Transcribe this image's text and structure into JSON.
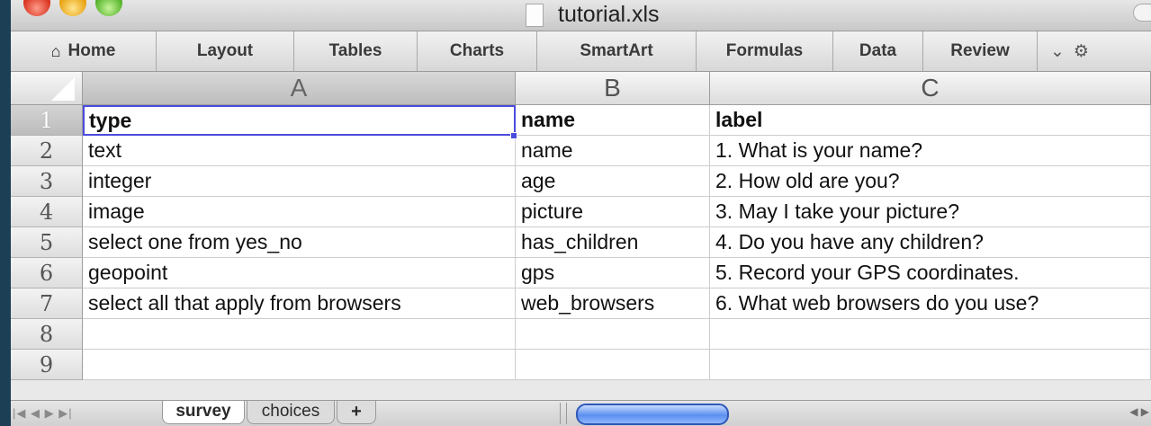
{
  "window": {
    "title": "tutorial.xls"
  },
  "ribbon": {
    "tabs": [
      "Home",
      "Layout",
      "Tables",
      "Charts",
      "SmartArt",
      "Formulas",
      "Data",
      "Review"
    ],
    "overflow_icon": "chevron-down-icon",
    "settings_icon": "gear-icon"
  },
  "columns": [
    "A",
    "B",
    "C"
  ],
  "rows": [
    {
      "num": "1",
      "cells": [
        "type",
        "name",
        "label"
      ]
    },
    {
      "num": "2",
      "cells": [
        "text",
        "name",
        "1. What is your name?"
      ]
    },
    {
      "num": "3",
      "cells": [
        "integer",
        "age",
        "2. How old are you?"
      ]
    },
    {
      "num": "4",
      "cells": [
        "image",
        "picture",
        "3. May I take your picture?"
      ]
    },
    {
      "num": "5",
      "cells": [
        "select one from yes_no",
        "has_children",
        "4. Do you have any children?"
      ]
    },
    {
      "num": "6",
      "cells": [
        "geopoint",
        "gps",
        "5. Record your GPS coordinates."
      ]
    },
    {
      "num": "7",
      "cells": [
        "select all that apply from browsers",
        "web_browsers",
        "6. What web browsers do you use?"
      ]
    },
    {
      "num": "8",
      "cells": [
        "",
        "",
        ""
      ]
    },
    {
      "num": "9",
      "cells": [
        "",
        "",
        ""
      ]
    }
  ],
  "sheets": {
    "tabs": [
      "survey",
      "choices"
    ],
    "active": "survey",
    "add_label": "+"
  },
  "colors": {
    "selection": "#4b4bdd",
    "scroll_thumb": "#5b8ef0"
  }
}
